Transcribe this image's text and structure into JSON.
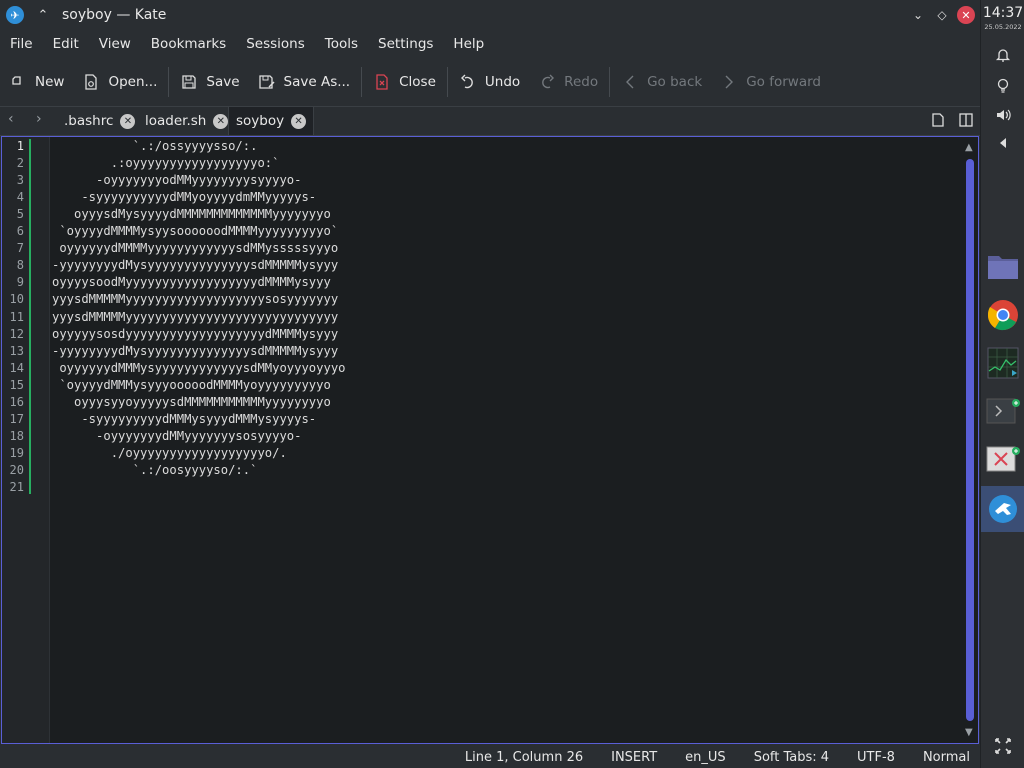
{
  "window": {
    "title": "soyboy — Kate"
  },
  "menu": [
    "File",
    "Edit",
    "View",
    "Bookmarks",
    "Sessions",
    "Tools",
    "Settings",
    "Help"
  ],
  "toolbar": {
    "new": "New",
    "open": "Open...",
    "save": "Save",
    "save_as": "Save As...",
    "close": "Close",
    "undo": "Undo",
    "redo": "Redo",
    "go_back": "Go back",
    "go_forward": "Go forward"
  },
  "tabs": [
    {
      "label": ".bashrc"
    },
    {
      "label": "loader.sh"
    },
    {
      "label": "soyboy"
    }
  ],
  "line_numbers": [
    "1",
    "2",
    "3",
    "4",
    "5",
    "6",
    "7",
    "8",
    "9",
    "10",
    "11",
    "12",
    "13",
    "14",
    "15",
    "16",
    "17",
    "18",
    "19",
    "20",
    "21"
  ],
  "code_lines": [
    "           `.:/ossyyyysso/:.",
    "        .:oyyyyyyyyyyyyyyyyyo:`",
    "      -oyyyyyyyodMMyyyyyyyysyyyyo-",
    "    -syyyyyyyyyydMMyoyyyydmMMyyyyys-",
    "   oyyysdMysyyyydMMMMMMMMMMMMMyyyyyyyo",
    " `oyyyydMMMMysyysoooooodMMMMyyyyyyyyyo`",
    " oyyyyyydMMMMyyyyyyyyyyyysdMMysssssyyyo",
    "-yyyyyyyydMysyyyyyyyyyyyyyysdMMMMMysyyy",
    "oyyyysoodMyyyyyyyyyyyyyyyyyydMMMMysyyy",
    "yyysdMMMMMyyyyyyyyyyyyyyyyyyysosyyyyyyy",
    "yyysdMMMMMyyyyyyyyyyyyyyyyyyyyyyyyyyyyy",
    "oyyyyysosdyyyyyyyyyyyyyyyyyyydMMMMysyyy",
    "-yyyyyyyydMysyyyyyyyyyyyyyysdMMMMMysyyy",
    " oyyyyyydMMMysyyyyyyyyyyyysdMMyoyyyoyyyo",
    " `oyyyydMMMysyyyooooodMMMMyoyyyyyyyyyo",
    "   oyyysyyoyyyyysdMMMMMMMMMMMyyyyyyyyo",
    "    -syyyyyyyyydMMMysyyydMMMysyyyys-",
    "      -oyyyyyyydMMyyyyyyysosyyyyo-",
    "        ./oyyyyyyyyyyyyyyyyyyo/.",
    "           `.:/oosyyyyso/:.`",
    ""
  ],
  "status": {
    "position": "Line 1, Column 26",
    "mode": "INSERT",
    "language": "en_US",
    "indent": "Soft Tabs: 4",
    "encoding": "UTF-8",
    "input_mode": "Normal"
  },
  "panel": {
    "time": "14:37",
    "date": "25.05.2022"
  },
  "colors": {
    "accent": "#5a5fd6",
    "modified_line": "#27ae60",
    "close_button": "#da4453"
  }
}
